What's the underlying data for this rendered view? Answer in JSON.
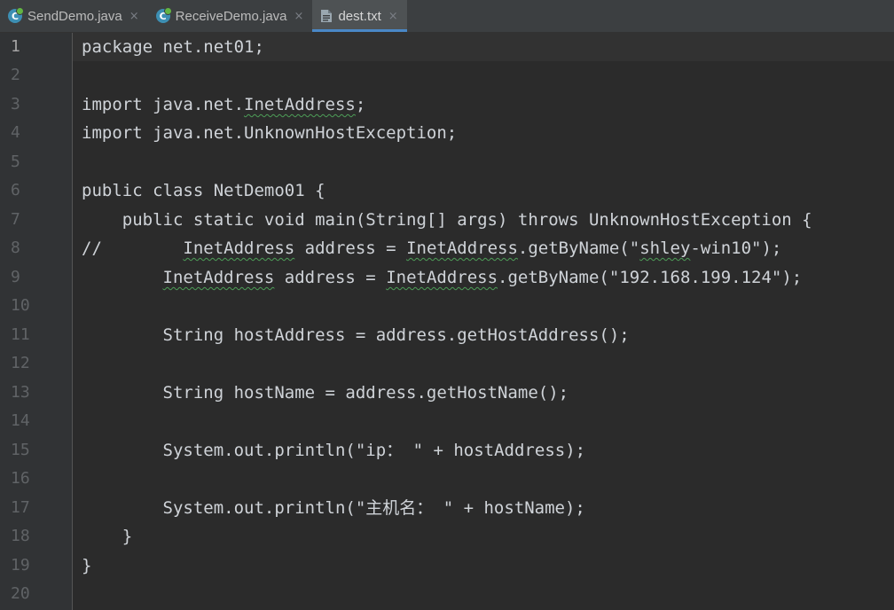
{
  "tabs": [
    {
      "label": "SendDemo.java",
      "icon": "java-class-icon",
      "active": false
    },
    {
      "label": "ReceiveDemo.java",
      "icon": "java-class-icon",
      "active": false
    },
    {
      "label": "dest.txt",
      "icon": "text-file-icon",
      "active": true
    }
  ],
  "close_glyph": "×",
  "line_numbers": [
    "1",
    "2",
    "3",
    "4",
    "5",
    "6",
    "7",
    "8",
    "9",
    "10",
    "11",
    "12",
    "13",
    "14",
    "15",
    "16",
    "17",
    "18",
    "19",
    "20"
  ],
  "code": {
    "l1": "package net.net01;",
    "l3_a": "import java.net.",
    "l3_b": "InetAddress",
    "l3_c": ";",
    "l4": "import java.net.UnknownHostException;",
    "l6": "public class NetDemo01 {",
    "l7": "    public static void main(String[] args) throws UnknownHostException {",
    "l8_a": "//        ",
    "l8_b": "InetAddress",
    "l8_c": " address = ",
    "l8_d": "InetAddress",
    "l8_e": ".getByName(\"",
    "l8_f": "shley",
    "l8_g": "-win10\");",
    "l9_a": "        ",
    "l9_b": "InetAddress",
    "l9_c": " address = ",
    "l9_d": "InetAddress",
    "l9_e": ".getByName(\"192.168.199.124\");",
    "l11": "        String hostAddress = address.getHostAddress();",
    "l13": "        String hostName = address.getHostName();",
    "l15": "        System.out.println(\"ip： \" + hostAddress);",
    "l17": "        System.out.println(\"主机名： \" + hostName);",
    "l18": "    }",
    "l19": "}"
  }
}
